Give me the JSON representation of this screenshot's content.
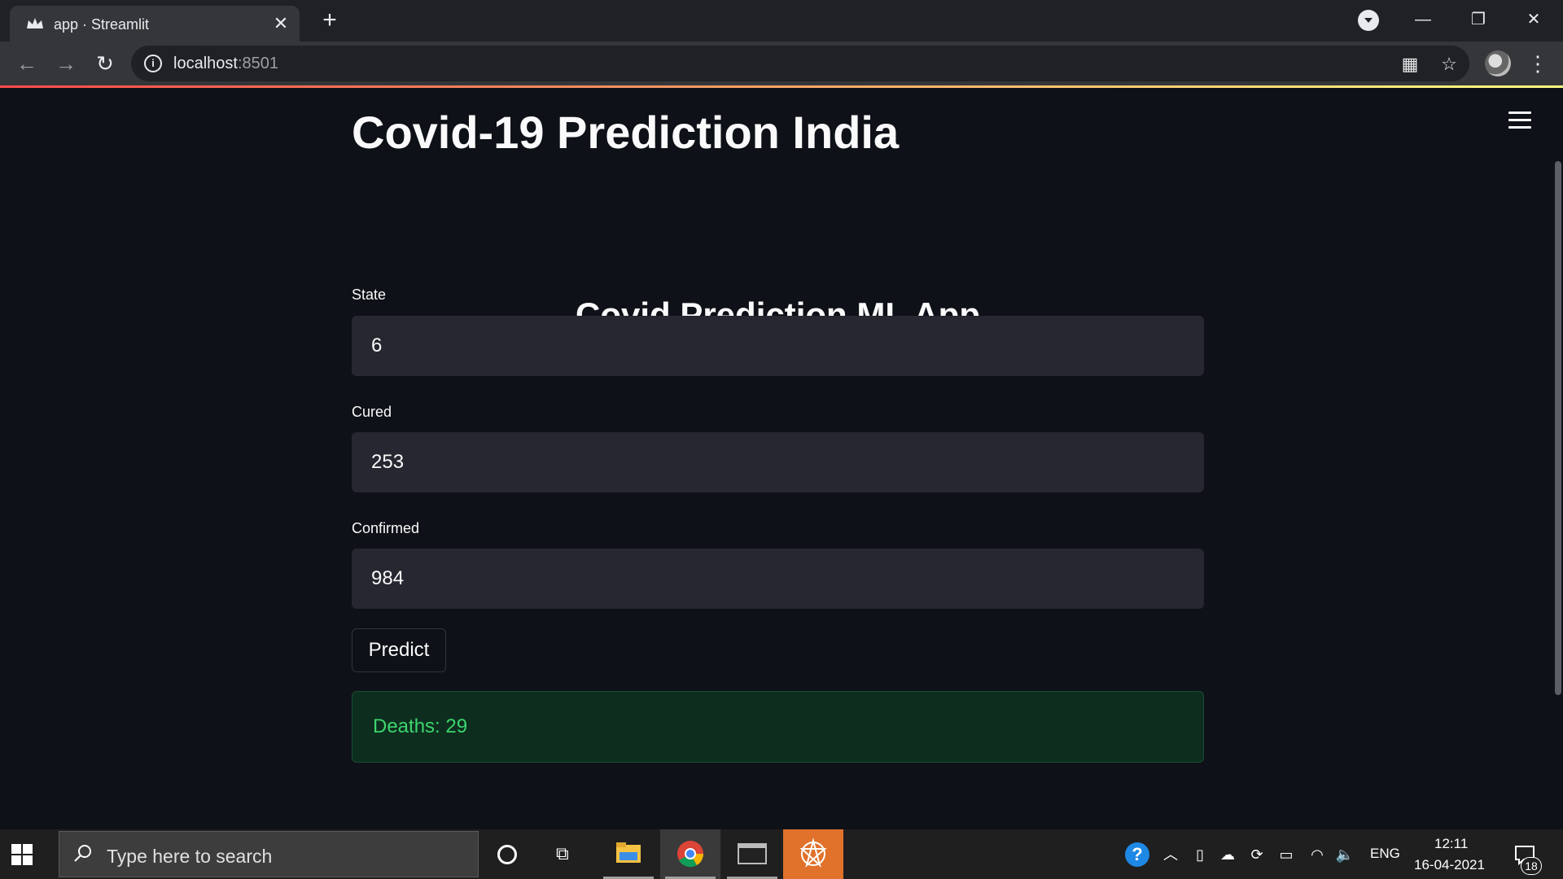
{
  "browser": {
    "tab_title": "app · Streamlit",
    "url_host": "localhost",
    "url_port": ":8501"
  },
  "app": {
    "title": "Covid-19 Prediction India",
    "subtitle": "Covid Prediction ML App",
    "fields": [
      {
        "label": "State",
        "value": "6"
      },
      {
        "label": "Cured",
        "value": "253"
      },
      {
        "label": "Confirmed",
        "value": "984"
      }
    ],
    "predict_label": "Predict",
    "result_text": "Deaths: 29",
    "colors": {
      "background": "#0e1117",
      "input_bg": "#262730",
      "success_bg": "#0d2e1f",
      "success_text": "#3dd56d"
    }
  },
  "taskbar": {
    "search_placeholder": "Type here to search",
    "language": "ENG",
    "time": "12:11",
    "date": "16-04-2021",
    "notification_count": "18"
  }
}
